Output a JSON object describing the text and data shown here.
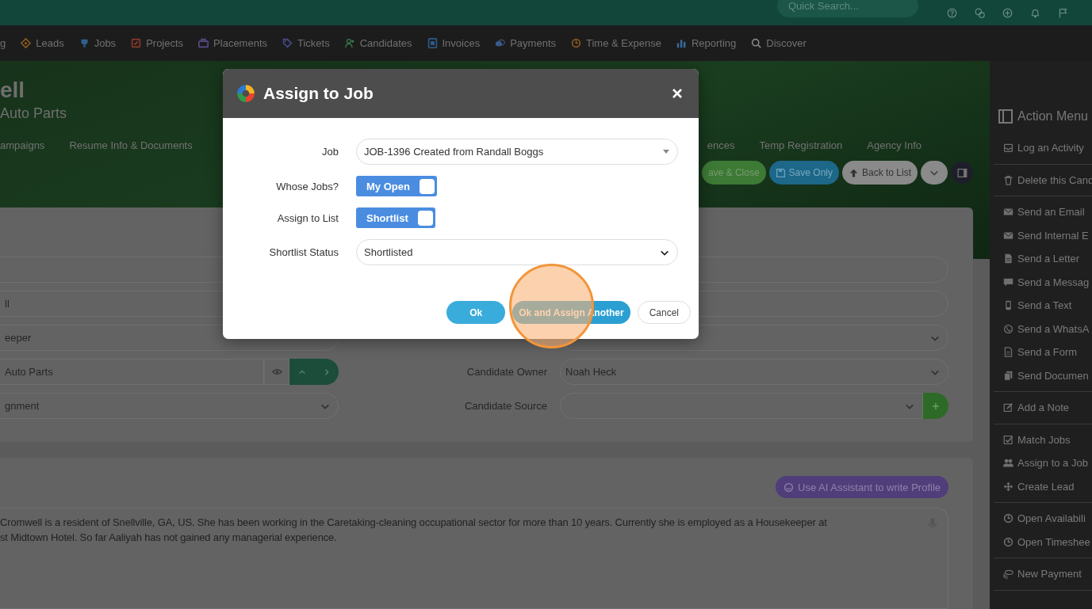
{
  "top_bar": {
    "search": {
      "placeholder": "Quick Search..."
    }
  },
  "nav": [
    {
      "label": "g"
    },
    {
      "label": "Leads"
    },
    {
      "label": "Jobs"
    },
    {
      "label": "Projects"
    },
    {
      "label": "Placements"
    },
    {
      "label": "Tickets"
    },
    {
      "label": "Candidates"
    },
    {
      "label": "Invoices"
    },
    {
      "label": "Payments"
    },
    {
      "label": "Time & Expense"
    },
    {
      "label": "Reporting"
    },
    {
      "label": "Discover"
    }
  ],
  "header": {
    "name": "ell",
    "company": "Auto Parts",
    "tabs": [
      {
        "label": "ampaigns"
      },
      {
        "label": "Resume Info & Documents"
      },
      {
        "label": "ences"
      },
      {
        "label": "Temp Registration"
      },
      {
        "label": "Agency Info"
      }
    ],
    "buttons": [
      {
        "kind": "green",
        "label": "ave & Close"
      },
      {
        "kind": "save",
        "label": "Save Only"
      },
      {
        "kind": "back",
        "label": "Back to List"
      },
      {
        "kind": "caret"
      },
      {
        "kind": "panel"
      }
    ]
  },
  "form": {
    "left_fields": [
      {
        "kind": "input"
      },
      {
        "kind": "input",
        "value": "ll"
      },
      {
        "kind": "input",
        "value": "eeper"
      },
      {
        "kind": "lookup",
        "value": "Auto Parts"
      },
      {
        "kind": "select",
        "value": "gnment"
      }
    ],
    "right_fields": [
      {
        "kind": "input"
      },
      {
        "kind": "input"
      },
      {
        "kind": "select"
      },
      {
        "label": "Candidate Owner",
        "kind": "select",
        "value": "Noah Heck"
      },
      {
        "label": "Candidate Source",
        "kind": "add"
      }
    ]
  },
  "profile": {
    "ai_button": "Use AI Assistant to write Profile",
    "lines": [
      "Cromwell is a resident of Snellville, GA, US. She has been working in the Caretaking-cleaning occupational sector for more than 10 years. Currently she is employed as a Housekeeper at",
      "st Midtown Hotel. So far Aaliyah has not gained any managerial experience."
    ]
  },
  "action_menu": {
    "title": "Action Menu",
    "items": [
      {
        "label": "Log an Activity",
        "group_end": true
      },
      {
        "label": "Delete this Cand",
        "group_end": true
      },
      {
        "label": "Send an Email",
        "group_end": false
      },
      {
        "label": "Send Internal E",
        "group_end": false
      },
      {
        "label": "Send a Letter",
        "group_end": false
      },
      {
        "label": "Send a Messag",
        "group_end": false
      },
      {
        "label": "Send a Text",
        "group_end": false
      },
      {
        "label": "Send a WhatsA",
        "group_end": false
      },
      {
        "label": "Send a Form",
        "group_end": false
      },
      {
        "label": "Send Documen",
        "group_end": true
      },
      {
        "label": "Add a Note",
        "group_end": true
      },
      {
        "label": "Match Jobs",
        "group_end": false
      },
      {
        "label": "Assign to a Job",
        "group_end": false
      },
      {
        "label": "Create Lead",
        "group_end": true
      },
      {
        "label": "Open Availabili",
        "group_end": false
      },
      {
        "label": "Open Timeshee",
        "group_end": true
      },
      {
        "label": "New Payment",
        "group_end": true
      }
    ]
  },
  "modal": {
    "title": "Assign to Job",
    "fields": [
      {
        "label": "Job",
        "kind": "dropdown",
        "value": "JOB-1396 Created from Randall Boggs"
      },
      {
        "label": "Whose Jobs?",
        "kind": "toggle",
        "value": "My Open",
        "on": true
      },
      {
        "label": "Assign to List",
        "kind": "toggle",
        "value": "Shortlist",
        "on": true
      },
      {
        "label": "Shortlist Status",
        "kind": "select",
        "value": "Shortlisted"
      }
    ],
    "buttons": [
      {
        "kind": "primary",
        "label": "Ok",
        "highlighted": false
      },
      {
        "kind": "secondary",
        "label": "Ok and Assign Another",
        "highlighted": true
      },
      {
        "kind": "cancel",
        "label": "Cancel",
        "highlighted": false
      }
    ]
  }
}
